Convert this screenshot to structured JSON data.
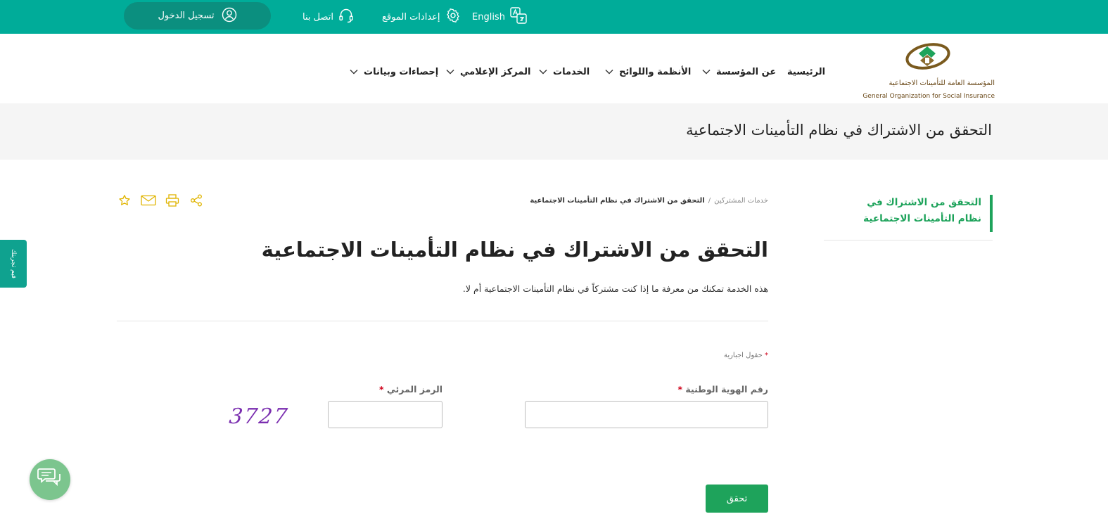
{
  "colors": {
    "topbar": "#00ac99",
    "accent": "#1ea35b",
    "feedback": "#0fa28f",
    "required": "#d0021b"
  },
  "topbar": {
    "login": {
      "label": "تسجيل الدخول",
      "icon": "user-circle-icon"
    },
    "contact": {
      "label": "اتصل بنا",
      "icon": "headset-icon"
    },
    "settings": {
      "label": "إعدادات الموقع",
      "icon": "gear-icon"
    },
    "language": {
      "label": "English",
      "icon": "language-icon"
    }
  },
  "logo": {
    "arabic": "المؤسسة العامة للتأمينات الاجتماعية",
    "english": "General Organization for Social Insurance"
  },
  "nav": {
    "items": [
      {
        "label": "الرئيسية",
        "has_dropdown": false
      },
      {
        "label": "عن المؤسسة",
        "has_dropdown": true
      },
      {
        "label": "الأنظمة واللوائح",
        "has_dropdown": true
      },
      {
        "label": "الخدمات",
        "has_dropdown": true
      },
      {
        "label": "المركز الإعلامي",
        "has_dropdown": true
      },
      {
        "label": "إحصاءات وبيانات",
        "has_dropdown": true
      }
    ]
  },
  "banner": {
    "title": "التحقق من الاشتراك في نظام التأمينات الاجتماعية"
  },
  "side_menu": {
    "active_item": "التحقق من الاشتراك في نظام التأمينات الاجتماعية"
  },
  "breadcrumb": {
    "parent": "خدمات المشتركين",
    "separator": "/",
    "current": "التحقق من الاشتراك في نظام التأمينات الاجتماعية"
  },
  "actions": {
    "icons": [
      "share-icon",
      "print-icon",
      "mail-icon",
      "star-icon"
    ]
  },
  "feedback_tab": {
    "label": "قيم تجربتك"
  },
  "main": {
    "title": "التحقق من الاشتراك في نظام التأمينات الاجتماعية",
    "description": "هذه الخدمة تمكنك من معرفة ما إذا كنت مشتركاً في نظام التأمينات الاجتماعية أم لا."
  },
  "form": {
    "required_star": "*",
    "required_note": "حقول اجبارية",
    "national_id": {
      "label": "رقم الهوية الوطنية",
      "value": "",
      "placeholder": ""
    },
    "captcha_input": {
      "label": "الرمز المرئي",
      "value": "",
      "placeholder": ""
    },
    "captcha_image": {
      "text": "3727"
    },
    "submit_label": "تحقق"
  },
  "chat": {
    "icon": "chat-bubbles-icon"
  }
}
